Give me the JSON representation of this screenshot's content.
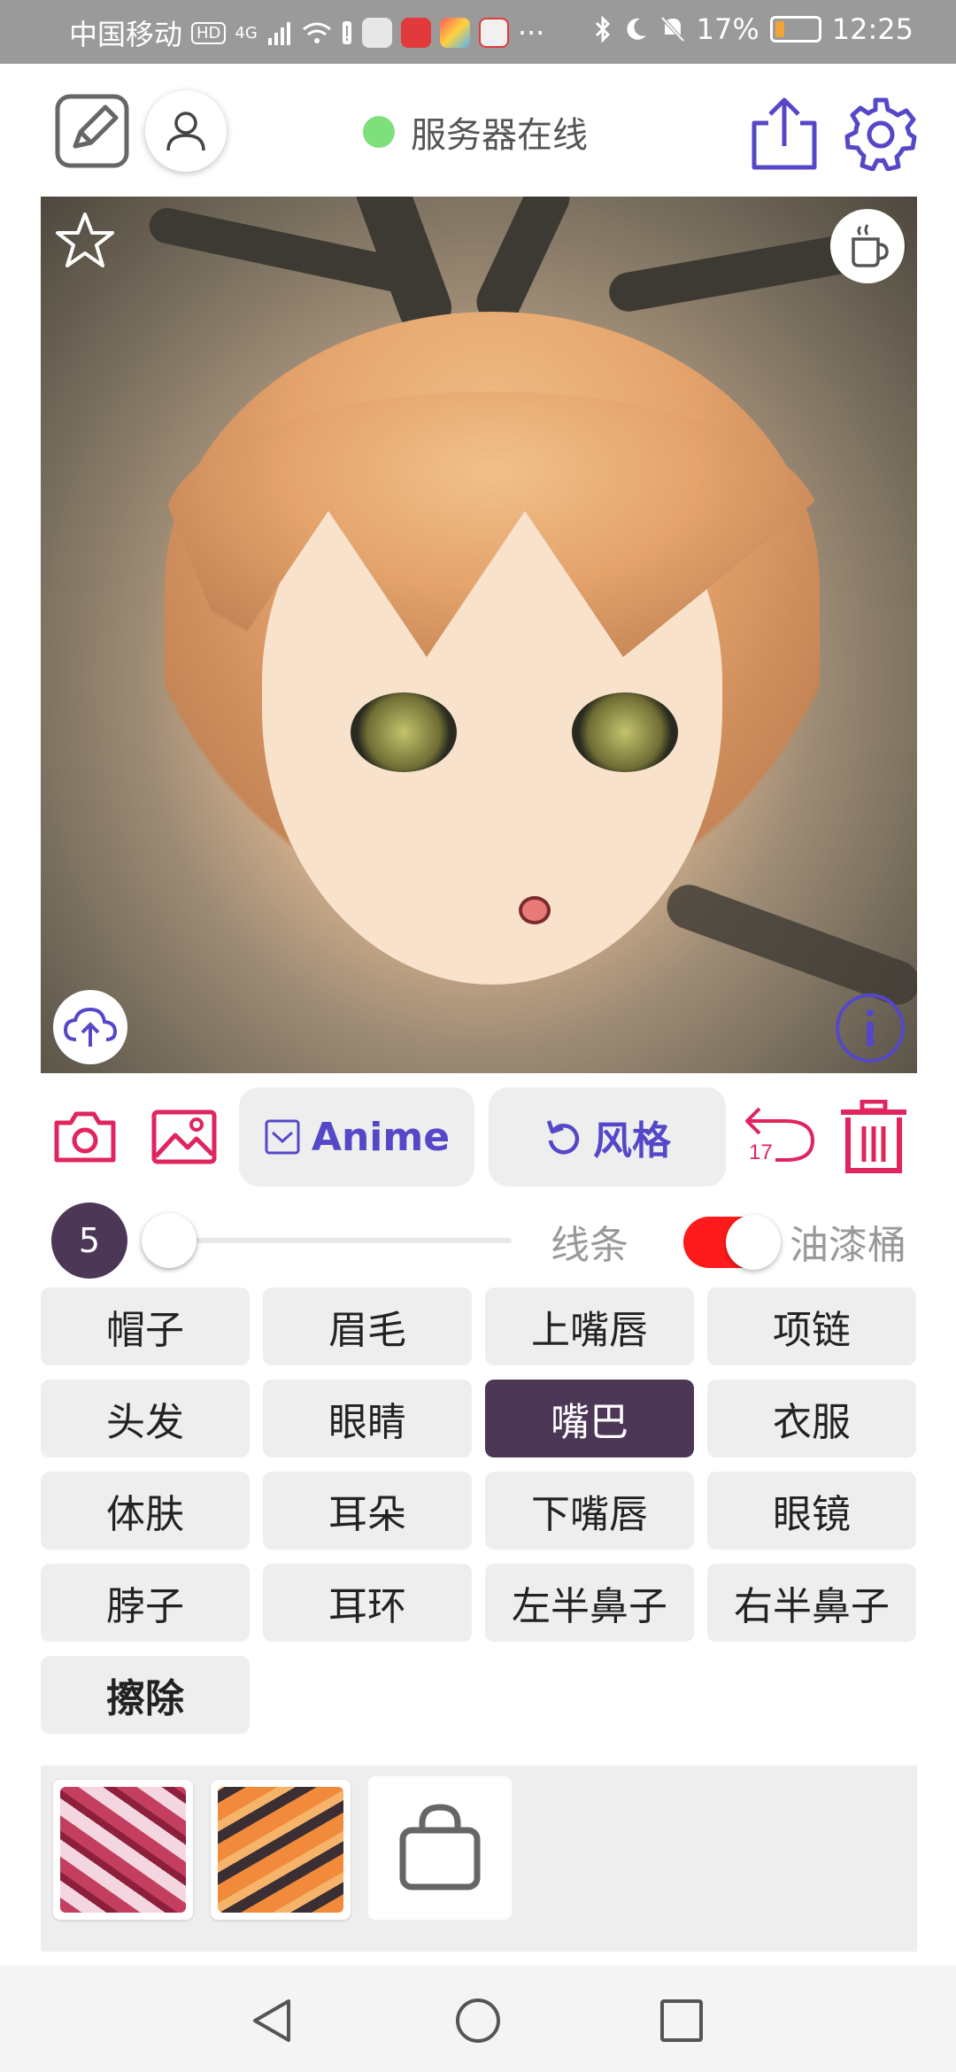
{
  "status_bar": {
    "carrier": "中国移动",
    "hd_badge": "HD",
    "network": "4G",
    "battery": "17%",
    "time": "12:25"
  },
  "header": {
    "server_status": "服务器在线",
    "status_color": "#7ee07a"
  },
  "tools": {
    "anime_label": "Anime",
    "style_label": "风格",
    "undo_count": "17",
    "accent_color": "#5548c8",
    "danger_color": "#e0245e"
  },
  "brush": {
    "size": "5",
    "line_label": "线条",
    "bucket_label": "油漆桶",
    "bucket_enabled": true,
    "slider_level": 0
  },
  "parts": [
    {
      "label": "帽子"
    },
    {
      "label": "眉毛"
    },
    {
      "label": "上嘴唇"
    },
    {
      "label": "项链"
    },
    {
      "label": "头发"
    },
    {
      "label": "眼睛"
    },
    {
      "label": "嘴巴"
    },
    {
      "label": "衣服"
    },
    {
      "label": "体肤"
    },
    {
      "label": "耳朵"
    },
    {
      "label": "下嘴唇"
    },
    {
      "label": "眼镜"
    },
    {
      "label": "脖子"
    },
    {
      "label": "耳环"
    },
    {
      "label": "左半鼻子"
    },
    {
      "label": "右半鼻子"
    },
    {
      "label": "擦除"
    }
  ],
  "selected_part": "嘴巴"
}
